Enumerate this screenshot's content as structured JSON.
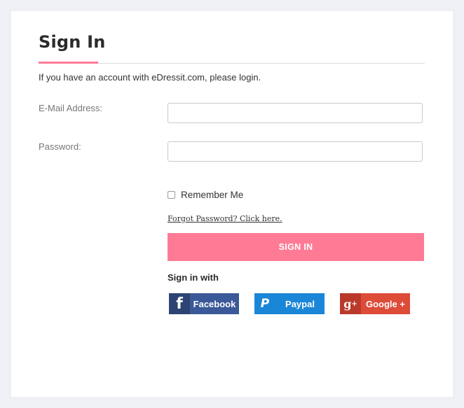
{
  "page": {
    "title": "Sign In",
    "intro": "If you have an account with eDressit.com, please login."
  },
  "form": {
    "email_label": "E-Mail Address:",
    "email_value": "",
    "password_label": "Password:",
    "password_value": "",
    "remember_label": "Remember Me",
    "remember_checked": false,
    "forgot_link": "Forgot Password? Click here.",
    "submit_label": "SIGN IN"
  },
  "social": {
    "heading": "Sign in with",
    "facebook_label": "Facebook",
    "paypal_label": "Paypal",
    "google_label": "Google +"
  },
  "colors": {
    "accent": "#ff7b95",
    "facebook": "#3b5998",
    "paypal": "#1a86d8",
    "google": "#dd4b39"
  },
  "icons": {
    "facebook": "facebook-icon",
    "paypal": "paypal-icon",
    "google": "google-plus-icon"
  }
}
